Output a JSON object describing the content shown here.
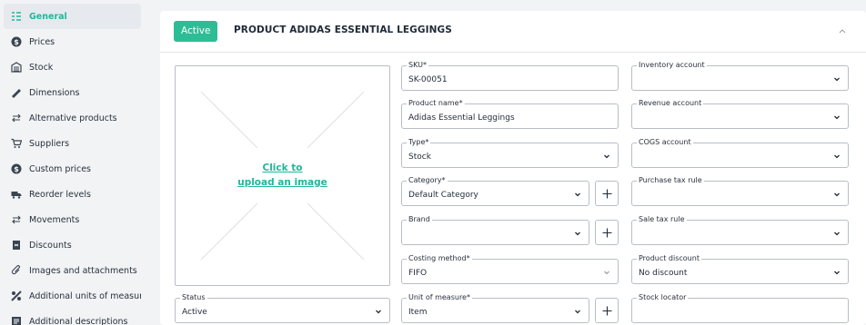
{
  "sidebar": {
    "items": [
      {
        "label": "General",
        "icon": "general-icon",
        "active": true
      },
      {
        "label": "Prices",
        "icon": "dollar-icon"
      },
      {
        "label": "Stock",
        "icon": "warehouse-icon"
      },
      {
        "label": "Dimensions",
        "icon": "ruler-icon"
      },
      {
        "label": "Alternative products",
        "icon": "swap-icon"
      },
      {
        "label": "Suppliers",
        "icon": "cart-icon"
      },
      {
        "label": "Custom prices",
        "icon": "dollar-icon"
      },
      {
        "label": "Reorder levels",
        "icon": "truck-icon"
      },
      {
        "label": "Movements",
        "icon": "swap-icon"
      },
      {
        "label": "Discounts",
        "icon": "tag-icon"
      },
      {
        "label": "Images and attachments",
        "icon": "paperclip-icon"
      },
      {
        "label": "Additional units of measure",
        "icon": "scale-icon"
      },
      {
        "label": "Additional descriptions",
        "icon": "document-icon"
      }
    ]
  },
  "header": {
    "status_badge": "Active",
    "title": "PRODUCT ADIDAS ESSENTIAL LEGGINGS"
  },
  "image_upload": {
    "line1": "Click to",
    "line2": "upload an image"
  },
  "form": {
    "sku": {
      "label": "SKU*",
      "value": "SK-00051"
    },
    "product_name": {
      "label": "Product name*",
      "value": "Adidas Essential Leggings"
    },
    "type": {
      "label": "Type*",
      "value": "Stock"
    },
    "category": {
      "label": "Category*",
      "value": "Default Category"
    },
    "brand": {
      "label": "Brand",
      "value": ""
    },
    "costing_method": {
      "label": "Costing method*",
      "value": "FIFO"
    },
    "unit_of_measure": {
      "label": "Unit of measure*",
      "value": "Item"
    },
    "status": {
      "label": "Status",
      "value": "Active"
    },
    "inventory_account": {
      "label": "Inventory account",
      "value": ""
    },
    "revenue_account": {
      "label": "Revenue account",
      "value": ""
    },
    "cogs_account": {
      "label": "COGS account",
      "value": ""
    },
    "purchase_tax_rule": {
      "label": "Purchase tax rule",
      "value": ""
    },
    "sale_tax_rule": {
      "label": "Sale tax rule",
      "value": ""
    },
    "product_discount": {
      "label": "Product discount",
      "value": "No discount"
    },
    "stock_locator": {
      "label": "Stock locator",
      "value": ""
    }
  },
  "colors": {
    "accent": "#20b79a",
    "badge": "#2dbd96",
    "border": "#b8bec6"
  }
}
